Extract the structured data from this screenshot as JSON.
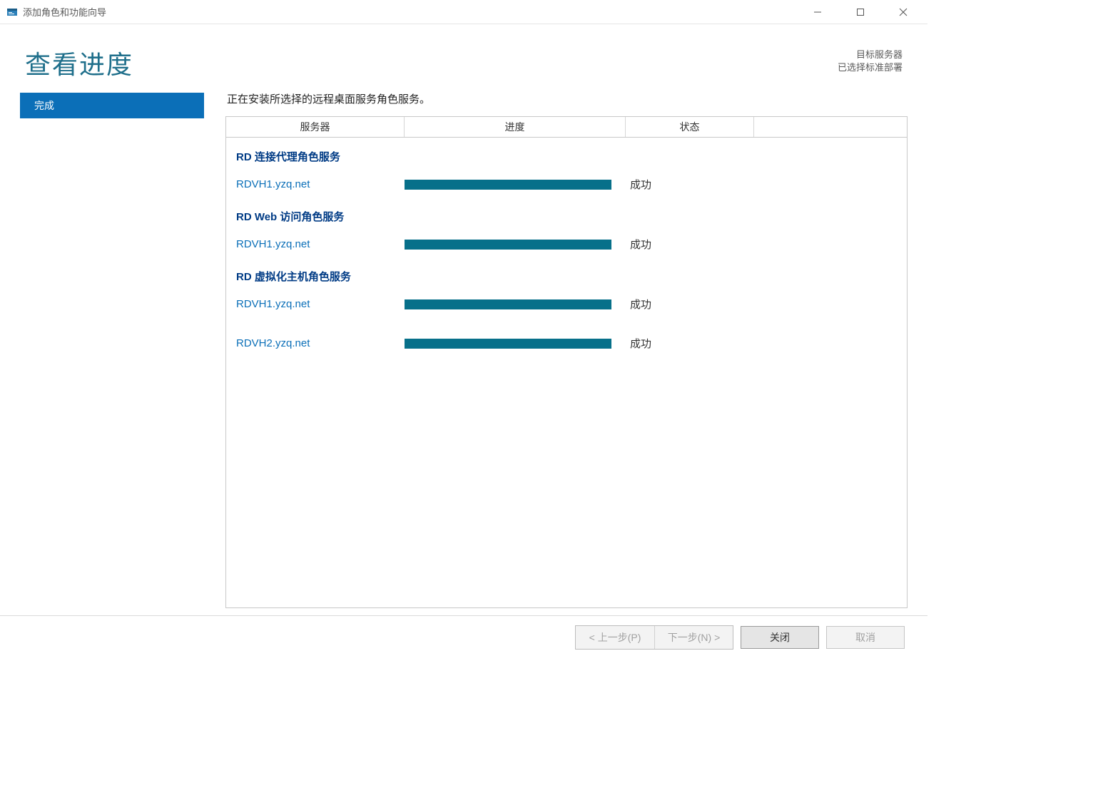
{
  "window": {
    "title": "添加角色和功能向导"
  },
  "header": {
    "page_title": "查看进度",
    "target_label": "目标服务器",
    "target_value": "已选择标准部署"
  },
  "sidebar": {
    "items": [
      {
        "label": "完成",
        "active": true
      }
    ]
  },
  "instruction": "正在安装所选择的远程桌面服务角色服务。",
  "table": {
    "columns": {
      "server": "服务器",
      "progress": "进度",
      "status": "状态"
    },
    "groups": [
      {
        "title": "RD 连接代理角色服务",
        "rows": [
          {
            "server": "RDVH1.yzq.net",
            "progress": 100,
            "status": "成功"
          }
        ]
      },
      {
        "title": "RD Web 访问角色服务",
        "rows": [
          {
            "server": "RDVH1.yzq.net",
            "progress": 100,
            "status": "成功"
          }
        ]
      },
      {
        "title": "RD 虚拟化主机角色服务",
        "rows": [
          {
            "server": "RDVH1.yzq.net",
            "progress": 100,
            "status": "成功"
          },
          {
            "server": "RDVH2.yzq.net",
            "progress": 100,
            "status": "成功"
          }
        ]
      }
    ]
  },
  "buttons": {
    "prev": "< 上一步(P)",
    "next": "下一步(N) >",
    "close": "关闭",
    "cancel": "取消"
  }
}
